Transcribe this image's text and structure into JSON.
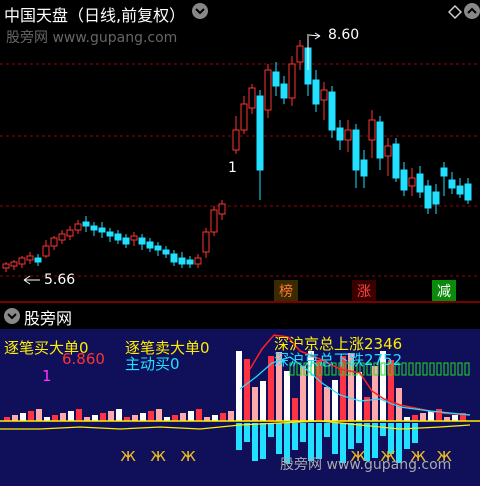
{
  "header": {
    "title": "中国天盘（日线,前复权）",
    "watermark": "股旁网 www.gupang.com"
  },
  "main_chart": {
    "high_label": "8.60",
    "low_label": "5.66",
    "marker_1": "1",
    "tags": [
      {
        "label": "榜",
        "color": "#ff7733"
      },
      {
        "label": "涨",
        "color": "#ff4444"
      },
      {
        "label": "减",
        "color": "#ffffff",
        "bg": "#0a8a0a"
      }
    ]
  },
  "sub_chart": {
    "title": "股旁网",
    "labels": {
      "buy_big": "逐笔买大单0",
      "sell_big": "逐笔卖大单0",
      "sh_sz_up": "深沪京总上涨2346",
      "sh_sz_down": "深沪京总下跌2752",
      "active_buy": "主动买0",
      "val_6860": "6.860",
      "val_1": "1"
    },
    "watermark": "股旁网 www.gupang.com"
  },
  "colors": {
    "up": "#ff3333",
    "down": "#22e0ff",
    "grid": "#a00000",
    "bg_sub": "#0f0f5a"
  }
}
